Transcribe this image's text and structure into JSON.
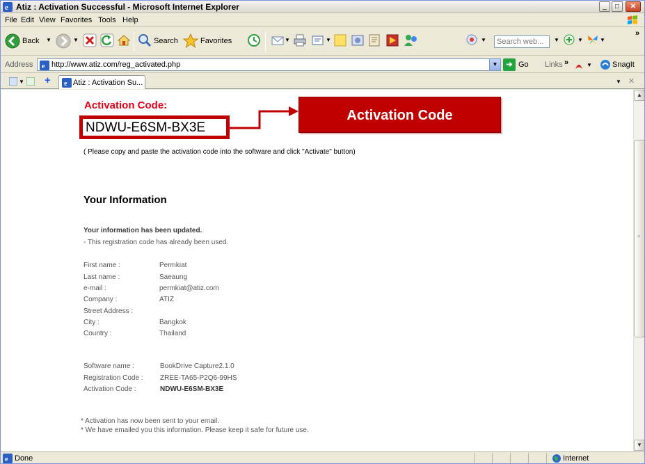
{
  "window": {
    "title": "Atiz : Activation Successful - Microsoft Internet Explorer",
    "minimize": "_",
    "maximize": "□",
    "close": "✕"
  },
  "menu": [
    "File",
    "Edit",
    "View",
    "Favorites",
    "Tools",
    "Help"
  ],
  "toolbar": {
    "back_label": "Back",
    "search_label": "Search",
    "favorites_label": "Favorites",
    "search_placeholder": "Search web..."
  },
  "address": {
    "label": "Address",
    "url": "http://www.atiz.com/reg_activated.php",
    "go_label": "Go",
    "links_label": "Links",
    "snagit_label": "SnagIt"
  },
  "tab": {
    "label": "Atiz : Activation Su..."
  },
  "page": {
    "activation_heading": "Activation Code:",
    "activation_code": "NDWU-E6SM-BX3E",
    "callout_label": "Activation Code",
    "copy_note": "( Please copy and paste the activation code into the software and click \"Activate\" button)",
    "info_heading": "Your Information",
    "updated_text": "Your information has been updated.",
    "used_text": "- This registration code has already been used.",
    "fields": [
      {
        "label": "First name :",
        "value": "Permkiat"
      },
      {
        "label": "Last name :",
        "value": "Saeaung"
      },
      {
        "label": "e-mail :",
        "value": "permkiat@atiz.com"
      },
      {
        "label": "Company :",
        "value": "ATIZ"
      },
      {
        "label": "Street Address :",
        "value": ""
      },
      {
        "label": "City :",
        "value": "Bangkok"
      },
      {
        "label": "Country :",
        "value": "Thailand"
      }
    ],
    "software_fields": [
      {
        "label": "Software name :",
        "value": "BookDrive Capture2.1.0"
      },
      {
        "label": "Registration Code :",
        "value": "ZREE-TA65-P2Q6-99HS"
      },
      {
        "label": "Activation Code :",
        "value": "NDWU-E6SM-BX3E"
      }
    ],
    "footnotes": [
      "* Activation has now been sent to your email.",
      "* We have emailed you this information. Please keep it safe for future use."
    ]
  },
  "status": {
    "text": "Done",
    "zone": "Internet"
  },
  "colors": {
    "accent_red": "#c00000",
    "heading_red": "#e3001b"
  }
}
